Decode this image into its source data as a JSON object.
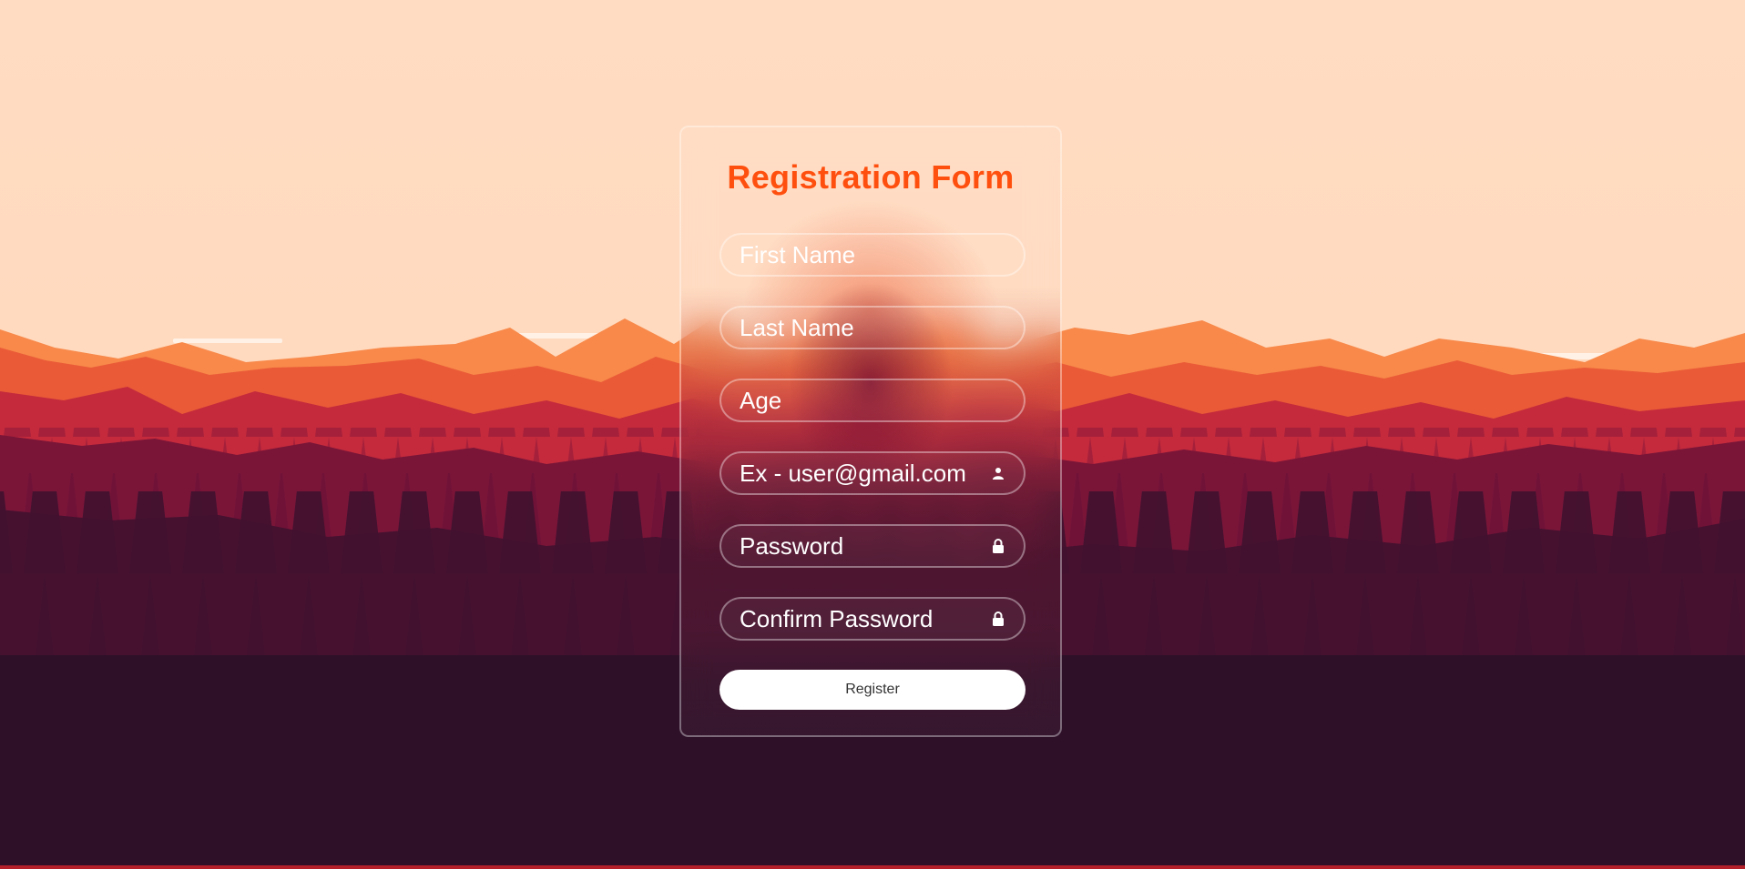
{
  "form": {
    "title": "Registration Form",
    "fields": [
      {
        "name": "first-name",
        "placeholder": "First Name",
        "icon": ""
      },
      {
        "name": "last-name",
        "placeholder": "Last Name",
        "icon": ""
      },
      {
        "name": "age",
        "placeholder": "Age",
        "icon": ""
      },
      {
        "name": "email",
        "placeholder": "Ex - user@gmail.com",
        "icon": "user-icon"
      },
      {
        "name": "password",
        "placeholder": "Password",
        "icon": "lock-icon"
      },
      {
        "name": "confirm-password",
        "placeholder": "Confirm Password",
        "icon": "lock-icon"
      }
    ],
    "register_label": "Register"
  },
  "colors": {
    "sky": "#ffdcc2",
    "title": "#ff4f0f",
    "button_bg": "#ffffff",
    "button_text": "#333333",
    "forest_dark": "#2e1029"
  }
}
